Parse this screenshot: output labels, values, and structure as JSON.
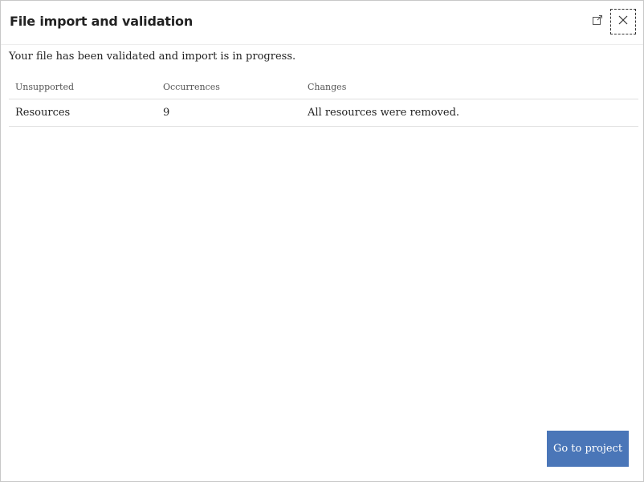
{
  "dialog": {
    "title": "File import and validation",
    "expand_icon": "expand-icon",
    "close_icon": "close-icon"
  },
  "status": {
    "message": "Your file has been validated and import is in progress."
  },
  "table": {
    "headers": [
      "Unsupported",
      "Occurrences",
      "Changes"
    ],
    "rows": [
      [
        "Resources",
        "9",
        "All resources were removed."
      ]
    ]
  },
  "footer": {
    "primary_button": "Go to project"
  },
  "colors": {
    "primary": "#4a76b8"
  }
}
